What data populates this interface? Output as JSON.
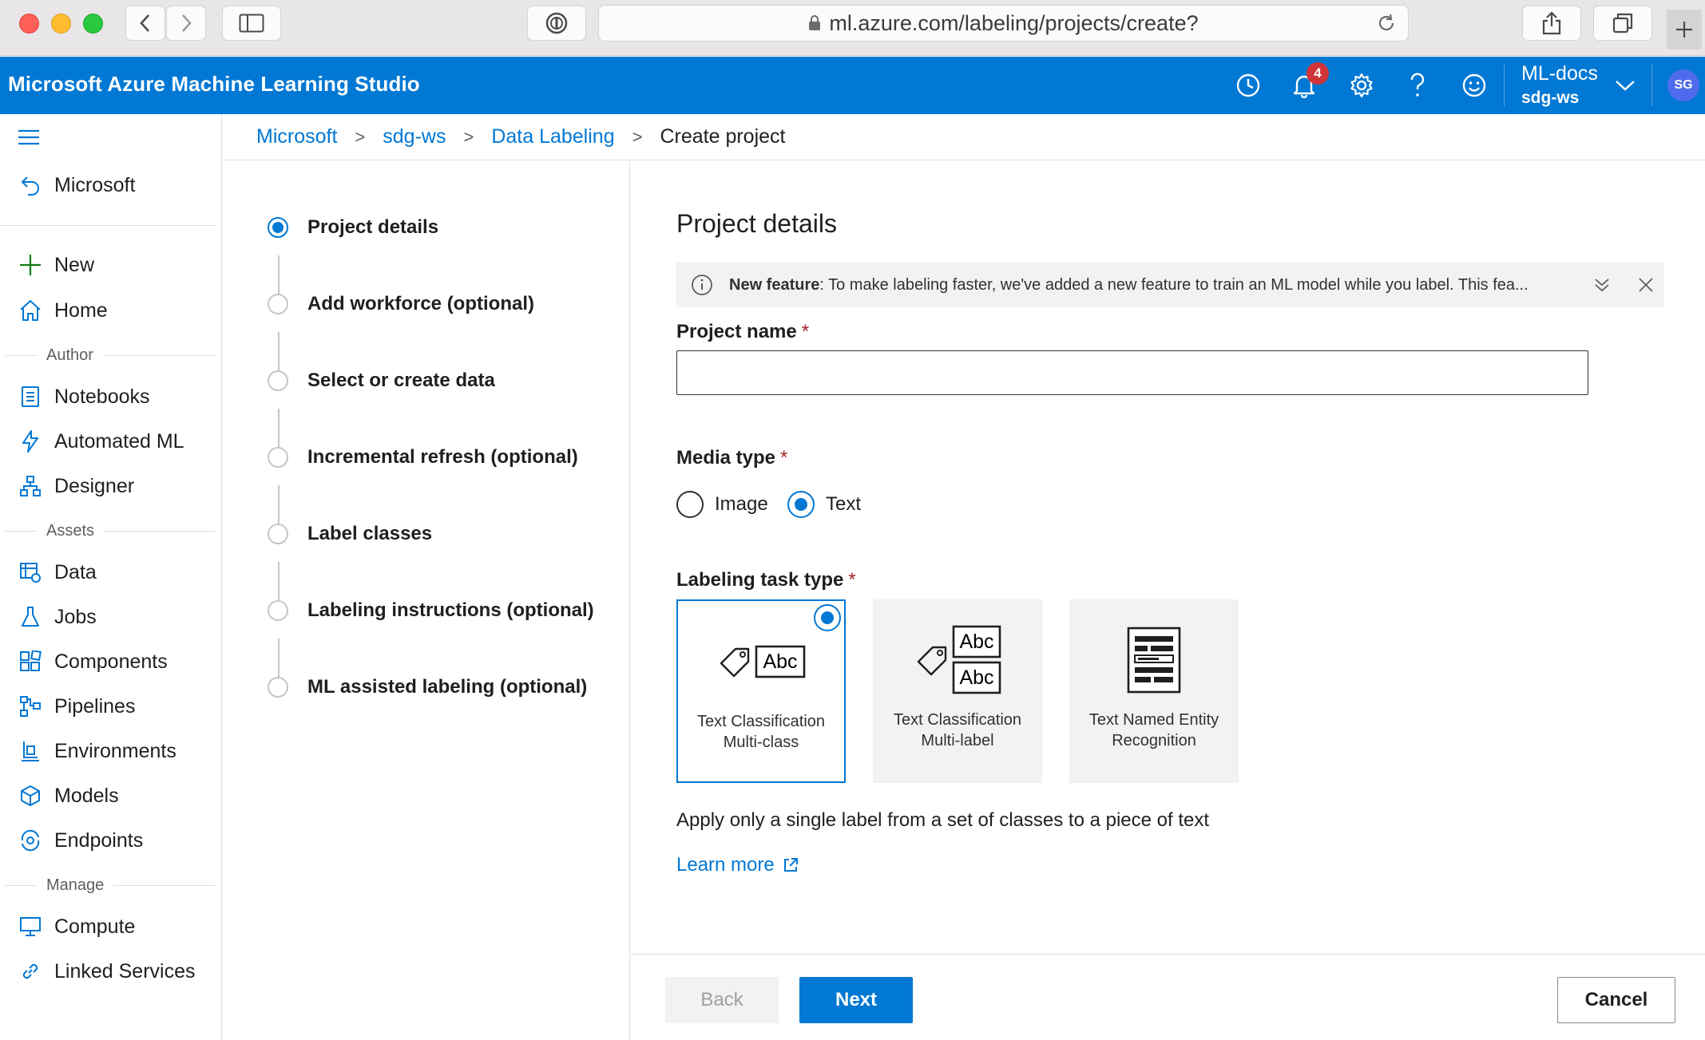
{
  "browser": {
    "url": "ml.azure.com/labeling/projects/create?",
    "colors": {
      "red": "#fe5f57",
      "yellow": "#febc2e",
      "green": "#28c840"
    }
  },
  "topbar": {
    "brand": "Microsoft Azure Machine Learning Studio",
    "notification_count": "4",
    "account_name": "ML-docs",
    "workspace": "sdg-ws",
    "avatar_initials": "SG",
    "accent": "#0078d4"
  },
  "nav": {
    "back_label": "Microsoft",
    "new_label": "New",
    "home_label": "Home",
    "group_author": "Author",
    "notebooks": "Notebooks",
    "automated_ml": "Automated ML",
    "designer": "Designer",
    "group_assets": "Assets",
    "data": "Data",
    "jobs": "Jobs",
    "components": "Components",
    "pipelines": "Pipelines",
    "environments": "Environments",
    "models": "Models",
    "endpoints": "Endpoints",
    "group_manage": "Manage",
    "compute": "Compute",
    "linked_services": "Linked Services"
  },
  "breadcrumb": {
    "c1": "Microsoft",
    "c2": "sdg-ws",
    "c3": "Data Labeling",
    "c4": "Create project",
    "separator": ">"
  },
  "steps": [
    {
      "label": "Project details",
      "active": true
    },
    {
      "label": "Add workforce (optional)"
    },
    {
      "label": "Select or create data"
    },
    {
      "label": "Incremental refresh (optional)"
    },
    {
      "label": "Label classes"
    },
    {
      "label": "Labeling instructions (optional)"
    },
    {
      "label": "ML assisted labeling (optional)"
    }
  ],
  "main": {
    "title": "Project details",
    "banner_bold": "New feature",
    "banner_text": ": To make labeling faster, we've added a new feature to train an ML model while you label. This fea...",
    "project_name_label": "Project name",
    "required_mark": "*",
    "project_name_value": "",
    "media_type_label": "Media type",
    "media_image": "Image",
    "media_text": "Text",
    "media_selected": "Text",
    "task_type_label": "Labeling task type",
    "cards": [
      {
        "line1": "Text Classification",
        "line2": "Multi-class",
        "selected": true
      },
      {
        "line1": "Text Classification",
        "line2": "Multi-label"
      },
      {
        "line1": "Text Named Entity",
        "line2": "Recognition"
      }
    ],
    "card_art_text": "Abc",
    "description": "Apply only a single label from a set of classes to a piece of text",
    "learn_more": "Learn more"
  },
  "footer": {
    "back": "Back",
    "next": "Next",
    "cancel": "Cancel"
  }
}
